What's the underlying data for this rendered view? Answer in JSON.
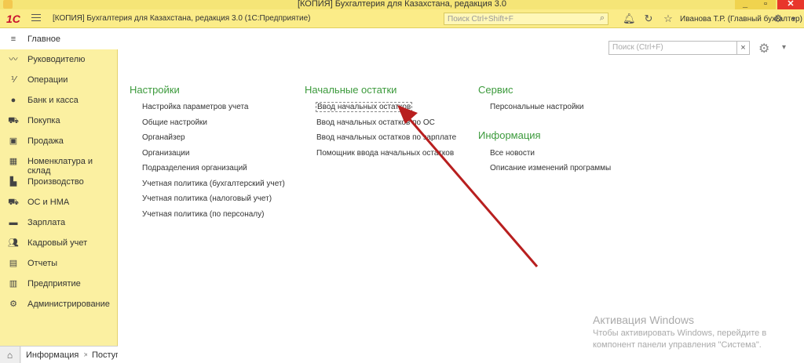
{
  "window": {
    "title": "[КОПИЯ] Бухгалтерия для Казахстана, редакция 3.0",
    "minimize_label": "_",
    "restore_label": "▫",
    "close_label": "✕"
  },
  "header": {
    "logo_text": "1С",
    "app_title": "[КОПИЯ] Бухгалтерия для Казахстана, редакция 3.0 (1С:Предприятие)",
    "search_placeholder": "Поиск Ctrl+Shift+F",
    "user": "Иванова Т.Р. (Главный бухгалтер)"
  },
  "sidebar": {
    "items": [
      {
        "label": "Главное",
        "icon": "menu-icon"
      },
      {
        "label": "Руководителю",
        "icon": "trend-icon"
      },
      {
        "label": "Операции",
        "icon": "operations-icon"
      },
      {
        "label": "Банк и касса",
        "icon": "coin-icon"
      },
      {
        "label": "Покупка",
        "icon": "cart-icon"
      },
      {
        "label": "Продажа",
        "icon": "bag-icon"
      },
      {
        "label": "Номенклатура и склад",
        "icon": "grid-icon"
      },
      {
        "label": "Производство",
        "icon": "factory-icon"
      },
      {
        "label": "ОС и НМА",
        "icon": "truck-icon"
      },
      {
        "label": "Зарплата",
        "icon": "money-icon"
      },
      {
        "label": "Кадровый учет",
        "icon": "people-icon"
      },
      {
        "label": "Отчеты",
        "icon": "chart-icon"
      },
      {
        "label": "Предприятие",
        "icon": "building-icon"
      },
      {
        "label": "Администрирование",
        "icon": "gear-icon"
      }
    ]
  },
  "tabs": {
    "items": [
      {
        "label": "Информация"
      },
      {
        "label": "Поступ"
      }
    ]
  },
  "main": {
    "search_placeholder": "Поиск (Ctrl+F)",
    "sections": {
      "settings": {
        "title": "Настройки",
        "links": [
          "Настройка параметров учета",
          "Общие настройки",
          "Органайзер",
          "Организации",
          "Подразделения организаций",
          "Учетная политика (бухгалтерский учет)",
          "Учетная политика (налоговый учет)",
          "Учетная политика (по персоналу)"
        ]
      },
      "opening": {
        "title": "Начальные остатки",
        "links": [
          "Ввод начальных остатков",
          "Ввод начальных остатков по ОС",
          "Ввод начальных остатков по зарплате",
          "Помощник ввода начальных остатков"
        ]
      },
      "service": {
        "title": "Сервис",
        "links": [
          "Персональные настройки"
        ]
      },
      "info": {
        "title": "Информация",
        "links": [
          "Все новости",
          "Описание изменений программы"
        ]
      }
    }
  },
  "watermark": {
    "line1": "Активация Windows",
    "line2": "Чтобы активировать Windows, перейдите в компонент панели управления \"Система\"."
  },
  "colors": {
    "accent_green": "#3c9a3c",
    "header_yellow": "#fbec88",
    "sidebar_yellow": "#fbf0a1",
    "arrow_red": "#b81f1f"
  }
}
